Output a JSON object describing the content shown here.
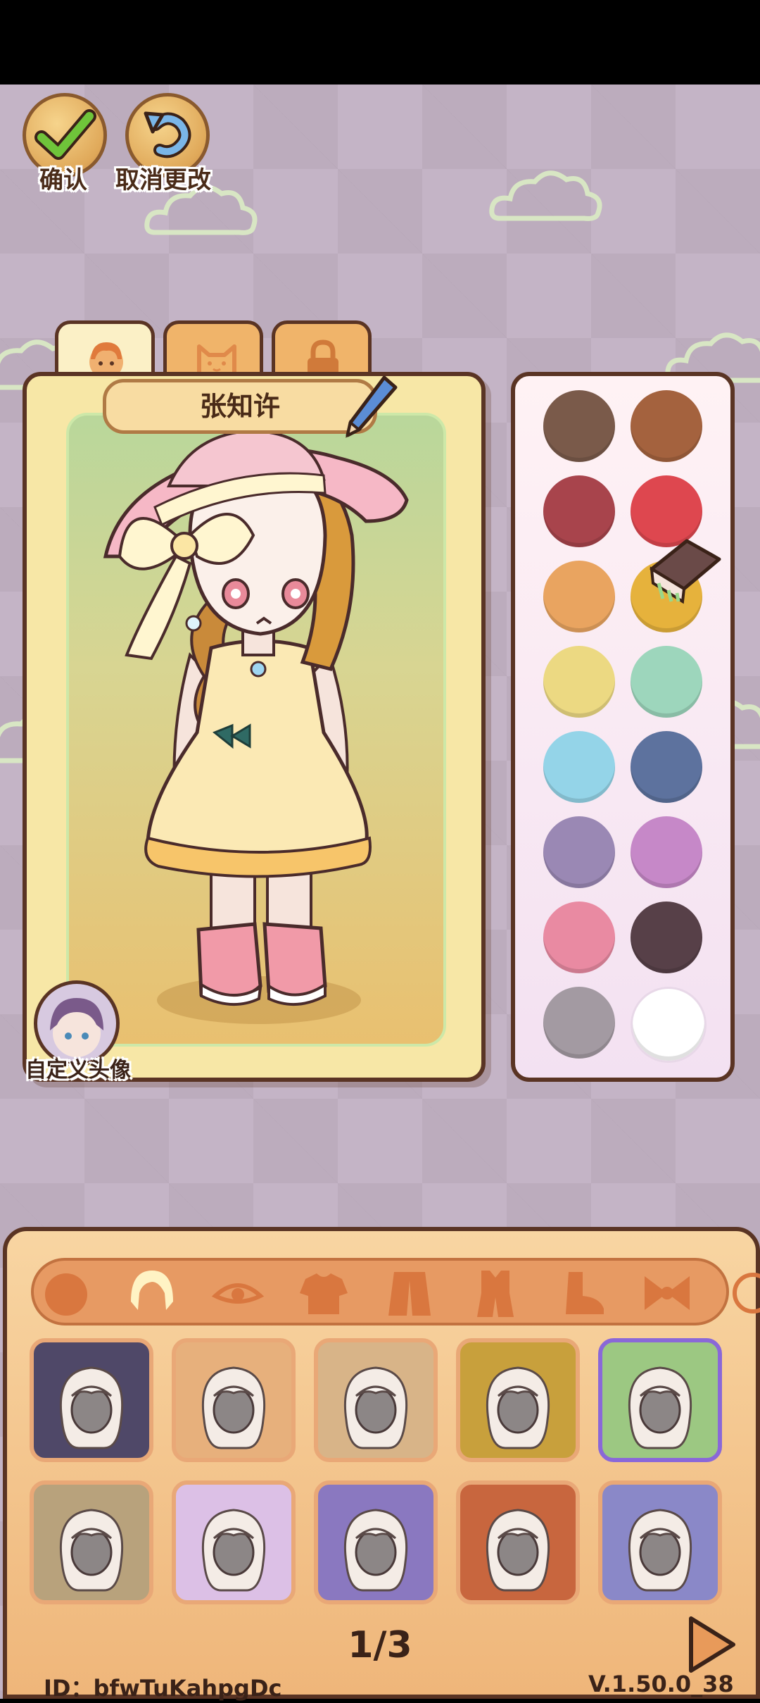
{
  "top_actions": {
    "confirm_label": "确认",
    "cancel_label": "取消更改"
  },
  "tabs": [
    {
      "icon": "girl-face-icon",
      "active": true
    },
    {
      "icon": "cat-face-icon",
      "active": false
    },
    {
      "icon": "lock-icon",
      "active": false
    }
  ],
  "character": {
    "name": "张知许",
    "avatar_label": "自定义头像"
  },
  "palette": {
    "swatches": [
      "#7a5a4a",
      "#a4623e",
      "#a8444c",
      "#de474f",
      "#e9a460",
      "#e6b23c",
      "#ecd982",
      "#9dd6bc",
      "#94d4e8",
      "#5d729e",
      "#9a88b4",
      "#c688c8",
      "#e98aa2",
      "#574048",
      "#a39aa2",
      "#ffffff"
    ]
  },
  "categories": [
    "face-icon",
    "hair-icon",
    "eye-icon",
    "top-icon",
    "coat-icon",
    "outfit-icon",
    "shoe-icon",
    "bow-icon",
    "more-icon"
  ],
  "items": {
    "backgrounds": [
      "#4f4868",
      "#e7b07c",
      "#d8b488",
      "#c8a03c",
      "#9cc882",
      "#b8a27c",
      "#dcc0e6",
      "#8a78c0",
      "#c8663e",
      "#8a88c8"
    ],
    "selected_index": 4
  },
  "pagination": {
    "indicator": "1/3"
  },
  "footer": {
    "user_id": "ID：bfwTuKahpgDc",
    "version": "V.1.50.0_38"
  }
}
